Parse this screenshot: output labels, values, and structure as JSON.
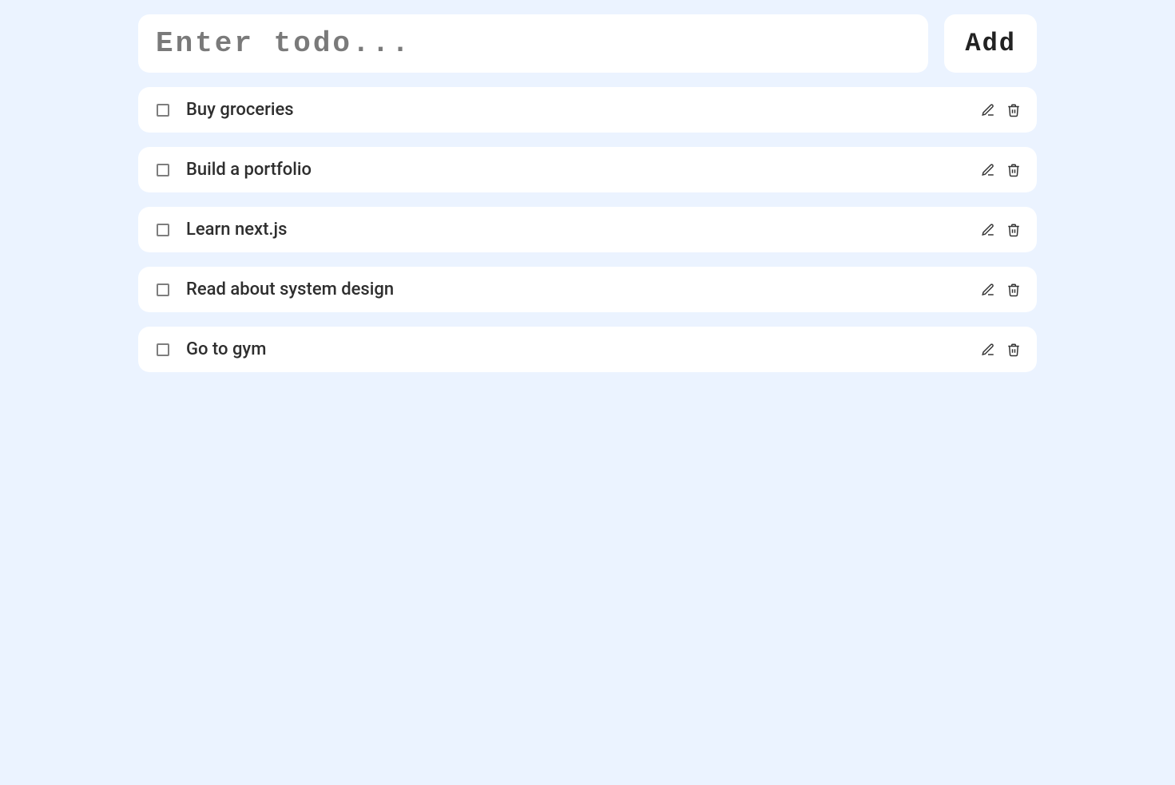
{
  "input": {
    "placeholder": "Enter todo...",
    "value": ""
  },
  "buttons": {
    "add_label": "Add"
  },
  "todos": [
    {
      "text": "Buy groceries",
      "done": false
    },
    {
      "text": "Build a portfolio",
      "done": false
    },
    {
      "text": "Learn next.js",
      "done": false
    },
    {
      "text": "Read about system design",
      "done": false
    },
    {
      "text": "Go to gym",
      "done": false
    }
  ]
}
